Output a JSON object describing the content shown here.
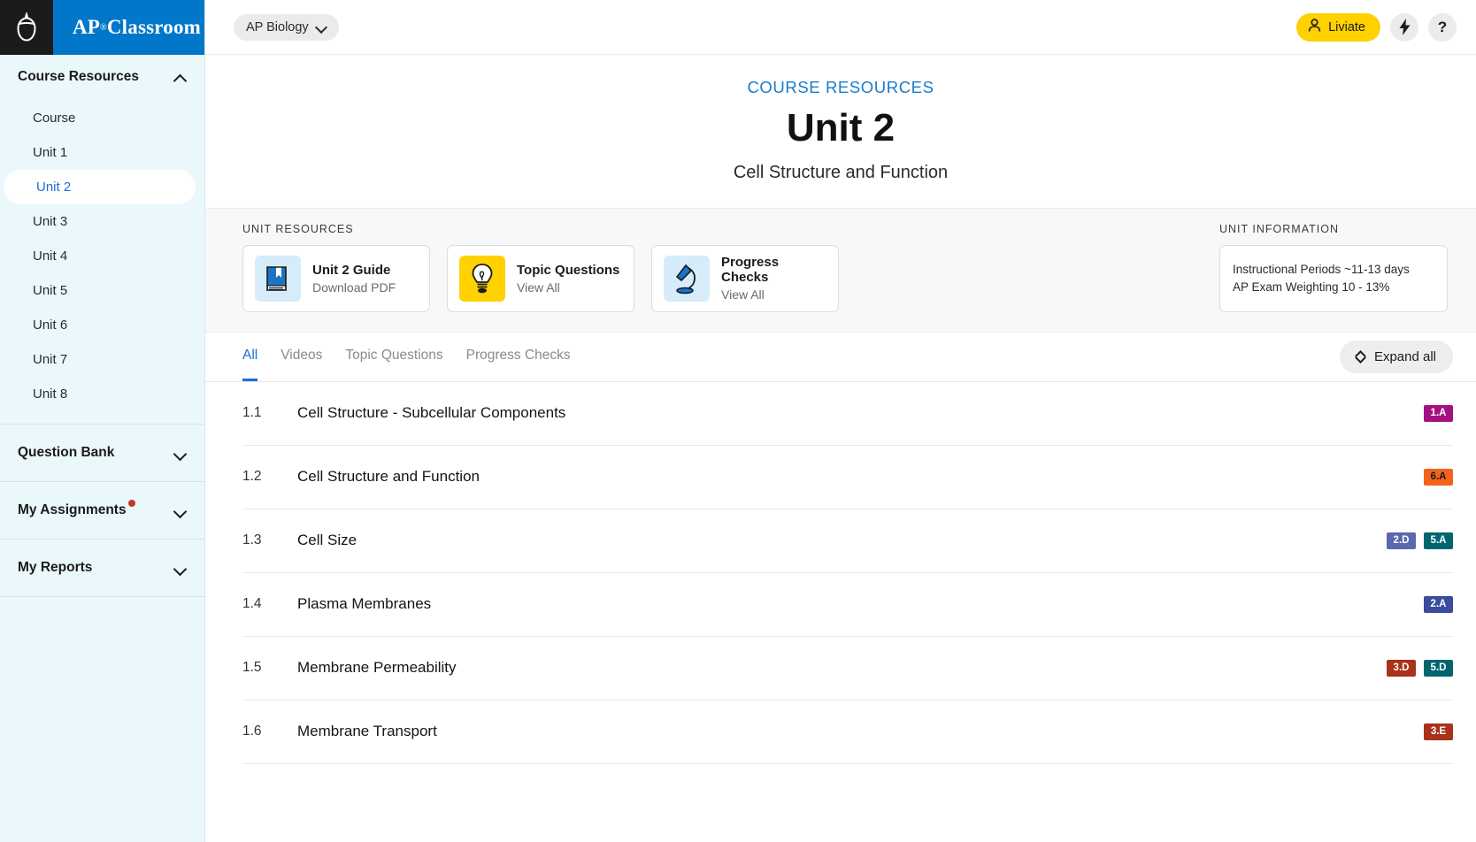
{
  "brand": {
    "name": "AP",
    "suffix": "Classroom",
    "acorn_icon": "acorn-icon"
  },
  "sidebar": {
    "sections": [
      {
        "label": "Course Resources",
        "expanded": true,
        "chevron": "chevron-up-icon"
      },
      {
        "label": "Question Bank",
        "expanded": false,
        "chevron": "chevron-down-icon"
      },
      {
        "label": "My Assignments",
        "expanded": false,
        "chevron": "chevron-down-icon",
        "has_notification": true
      },
      {
        "label": "My Reports",
        "expanded": false,
        "chevron": "chevron-down-icon"
      }
    ],
    "items": [
      {
        "label": "Course",
        "active": false
      },
      {
        "label": "Unit 1",
        "active": false
      },
      {
        "label": "Unit 2",
        "active": true
      },
      {
        "label": "Unit 3",
        "active": false
      },
      {
        "label": "Unit 4",
        "active": false
      },
      {
        "label": "Unit 5",
        "active": false
      },
      {
        "label": "Unit 6",
        "active": false
      },
      {
        "label": "Unit 7",
        "active": false
      },
      {
        "label": "Unit 8",
        "active": false
      }
    ]
  },
  "topbar": {
    "course_selector": "AP Biology",
    "user_name": "Liviate",
    "user_icon": "person-icon",
    "bolt_icon": "lightning-bolt-icon",
    "help_icon": "question-mark-icon",
    "help_label": "?"
  },
  "hero": {
    "eyebrow": "COURSE RESOURCES",
    "title": "Unit 2",
    "subtitle": "Cell Structure and Function"
  },
  "resources": {
    "label": "UNIT RESOURCES",
    "cards": [
      {
        "title": "Unit 2 Guide",
        "subtitle": "Download PDF",
        "icon": "book-icon",
        "icon_style": "blue"
      },
      {
        "title": "Topic Questions",
        "subtitle": "View All",
        "icon": "lightbulb-icon",
        "icon_style": "yellow"
      },
      {
        "title": "Progress Checks",
        "subtitle": "View All",
        "icon": "desk-lamp-icon",
        "icon_style": "blue"
      }
    ]
  },
  "unit_information": {
    "label": "UNIT INFORMATION",
    "rows": [
      "Instructional Periods  ~11-13 days",
      "AP Exam Weighting  10 - 13%"
    ]
  },
  "tabs": [
    {
      "label": "All",
      "active": true
    },
    {
      "label": "Videos",
      "active": false
    },
    {
      "label": "Topic Questions",
      "active": false
    },
    {
      "label": "Progress Checks",
      "active": false
    }
  ],
  "expand_all": {
    "label": "Expand all",
    "icon": "expand-collapse-icon"
  },
  "topics": [
    {
      "number": "1.1",
      "name": "Cell Structure - Subcellular Components",
      "badges": [
        {
          "label": "1.A",
          "color": "#a4117f",
          "text_color": "#ffffff"
        }
      ]
    },
    {
      "number": "1.2",
      "name": "Cell Structure and Function",
      "badges": [
        {
          "label": "6.A",
          "color": "#f4631e",
          "text_color": "#1b1b1b"
        }
      ]
    },
    {
      "number": "1.3",
      "name": "Cell Size",
      "badges": [
        {
          "label": "2.D",
          "color": "#5b68b0",
          "text_color": "#ffffff"
        },
        {
          "label": "5.A",
          "color": "#00656e",
          "text_color": "#ffffff"
        }
      ]
    },
    {
      "number": "1.4",
      "name": "Plasma Membranes",
      "badges": [
        {
          "label": "2.A",
          "color": "#3b4c9c",
          "text_color": "#ffffff"
        }
      ]
    },
    {
      "number": "1.5",
      "name": "Membrane Permeability",
      "badges": [
        {
          "label": "3.D",
          "color": "#a8321a",
          "text_color": "#ffffff"
        },
        {
          "label": "5.D",
          "color": "#00656e",
          "text_color": "#ffffff"
        }
      ]
    },
    {
      "number": "1.6",
      "name": "Membrane Transport",
      "badges": [
        {
          "label": "3.E",
          "color": "#a8321a",
          "text_color": "#ffffff"
        }
      ]
    }
  ],
  "colors": {
    "brand_blue": "#0077c8",
    "accent_yellow": "#ffd100",
    "link_blue": "#1a6ddb",
    "sidebar_bg": "#eaf7fb"
  }
}
